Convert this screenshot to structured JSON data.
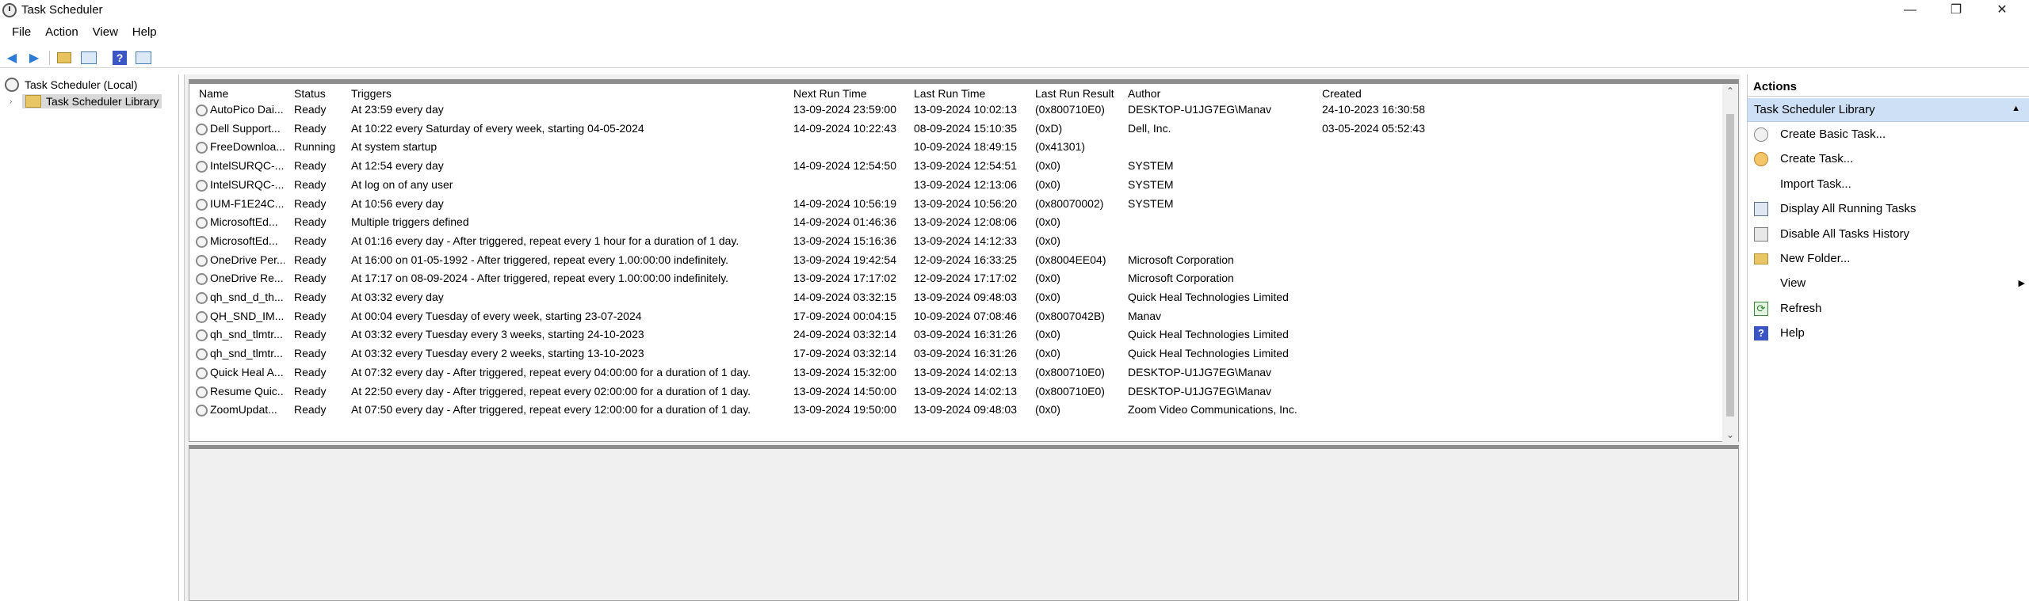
{
  "window": {
    "title": "Task Scheduler",
    "minimize": "—",
    "maximize": "❐",
    "close": "✕"
  },
  "menu": [
    "File",
    "Action",
    "View",
    "Help"
  ],
  "toolbar": {
    "back_icon": "◀",
    "forward_icon": "▶"
  },
  "tree": {
    "root": "Task Scheduler (Local)",
    "child": "Task Scheduler Library",
    "expander": "›"
  },
  "columns": [
    "Name",
    "Status",
    "Triggers",
    "Next Run Time",
    "Last Run Time",
    "Last Run Result",
    "Author",
    "Created"
  ],
  "tasks": [
    [
      "AutoPico Dai...",
      "Ready",
      "At 23:59 every day",
      "13-09-2024 23:59:00",
      "13-09-2024 10:02:13",
      "(0x800710E0)",
      "DESKTOP-U1JG7EG\\Manav",
      "24-10-2023 16:30:58"
    ],
    [
      "Dell Support...",
      "Ready",
      "At 10:22 every Saturday of every week, starting 04-05-2024",
      "14-09-2024 10:22:43",
      "08-09-2024 15:10:35",
      "(0xD)",
      "Dell, Inc.",
      "03-05-2024 05:52:43"
    ],
    [
      "FreeDownloa...",
      "Running",
      "At system startup",
      "",
      "10-09-2024 18:49:15",
      "(0x41301)",
      "",
      ""
    ],
    [
      "IntelSURQC-...",
      "Ready",
      "At 12:54 every day",
      "14-09-2024 12:54:50",
      "13-09-2024 12:54:51",
      "(0x0)",
      "SYSTEM",
      ""
    ],
    [
      "IntelSURQC-...",
      "Ready",
      "At log on of any user",
      "",
      "13-09-2024 12:13:06",
      "(0x0)",
      "SYSTEM",
      ""
    ],
    [
      "IUM-F1E24C...",
      "Ready",
      "At 10:56 every day",
      "14-09-2024 10:56:19",
      "13-09-2024 10:56:20",
      "(0x80070002)",
      "SYSTEM",
      ""
    ],
    [
      "MicrosoftEd...",
      "Ready",
      "Multiple triggers defined",
      "14-09-2024 01:46:36",
      "13-09-2024 12:08:06",
      "(0x0)",
      "",
      ""
    ],
    [
      "MicrosoftEd...",
      "Ready",
      "At 01:16 every day - After triggered, repeat every 1 hour for a duration of 1 day.",
      "13-09-2024 15:16:36",
      "13-09-2024 14:12:33",
      "(0x0)",
      "",
      ""
    ],
    [
      "OneDrive Per...",
      "Ready",
      "At 16:00 on 01-05-1992 - After triggered, repeat every 1.00:00:00 indefinitely.",
      "13-09-2024 19:42:54",
      "12-09-2024 16:33:25",
      "(0x8004EE04)",
      "Microsoft Corporation",
      ""
    ],
    [
      "OneDrive Re...",
      "Ready",
      "At 17:17 on 08-09-2024 - After triggered, repeat every 1.00:00:00 indefinitely.",
      "13-09-2024 17:17:02",
      "12-09-2024 17:17:02",
      "(0x0)",
      "Microsoft Corporation",
      ""
    ],
    [
      "qh_snd_d_th...",
      "Ready",
      "At 03:32 every day",
      "14-09-2024 03:32:15",
      "13-09-2024 09:48:03",
      "(0x0)",
      "Quick Heal Technologies Limited",
      ""
    ],
    [
      "QH_SND_IM...",
      "Ready",
      "At 00:04 every Tuesday of every week, starting 23-07-2024",
      "17-09-2024 00:04:15",
      "10-09-2024 07:08:46",
      "(0x8007042B)",
      "Manav",
      ""
    ],
    [
      "qh_snd_tlmtr...",
      "Ready",
      "At 03:32 every Tuesday every 3 weeks, starting 24-10-2023",
      "24-09-2024 03:32:14",
      "03-09-2024 16:31:26",
      "(0x0)",
      "Quick Heal Technologies Limited",
      ""
    ],
    [
      "qh_snd_tlmtr...",
      "Ready",
      "At 03:32 every Tuesday every 2 weeks, starting 13-10-2023",
      "17-09-2024 03:32:14",
      "03-09-2024 16:31:26",
      "(0x0)",
      "Quick Heal Technologies Limited",
      ""
    ],
    [
      "Quick Heal A...",
      "Ready",
      "At 07:32 every day - After triggered, repeat every 04:00:00 for a duration of 1 day.",
      "13-09-2024 15:32:00",
      "13-09-2024 14:02:13",
      "(0x800710E0)",
      "DESKTOP-U1JG7EG\\Manav",
      ""
    ],
    [
      "Resume Quic...",
      "Ready",
      "At 22:50 every day - After triggered, repeat every 02:00:00 for a duration of 1 day.",
      "13-09-2024 14:50:00",
      "13-09-2024 14:02:13",
      "(0x800710E0)",
      "DESKTOP-U1JG7EG\\Manav",
      ""
    ],
    [
      "ZoomUpdat...",
      "Ready",
      "At 07:50 every day - After triggered, repeat every 12:00:00 for a duration of 1 day.",
      "13-09-2024 19:50:00",
      "13-09-2024 09:48:03",
      "(0x0)",
      "Zoom Video Communications, Inc.",
      ""
    ]
  ],
  "actions": {
    "title": "Actions",
    "section": "Task Scheduler Library",
    "section_toggle": "▲",
    "submenu_arrow": "▶",
    "items": [
      {
        "label": "Create Basic Task...",
        "icon": "create-basic-task-icon"
      },
      {
        "label": "Create Task...",
        "icon": "create-task-icon"
      },
      {
        "label": "Import Task...",
        "icon": ""
      },
      {
        "label": "Display All Running Tasks",
        "icon": "running-tasks-icon"
      },
      {
        "label": "Disable All Tasks History",
        "icon": "history-icon"
      },
      {
        "label": "New Folder...",
        "icon": "folder-icon"
      },
      {
        "label": "View",
        "icon": ""
      },
      {
        "label": "Refresh",
        "icon": "refresh-icon"
      },
      {
        "label": "Help",
        "icon": "help-icon"
      }
    ]
  }
}
